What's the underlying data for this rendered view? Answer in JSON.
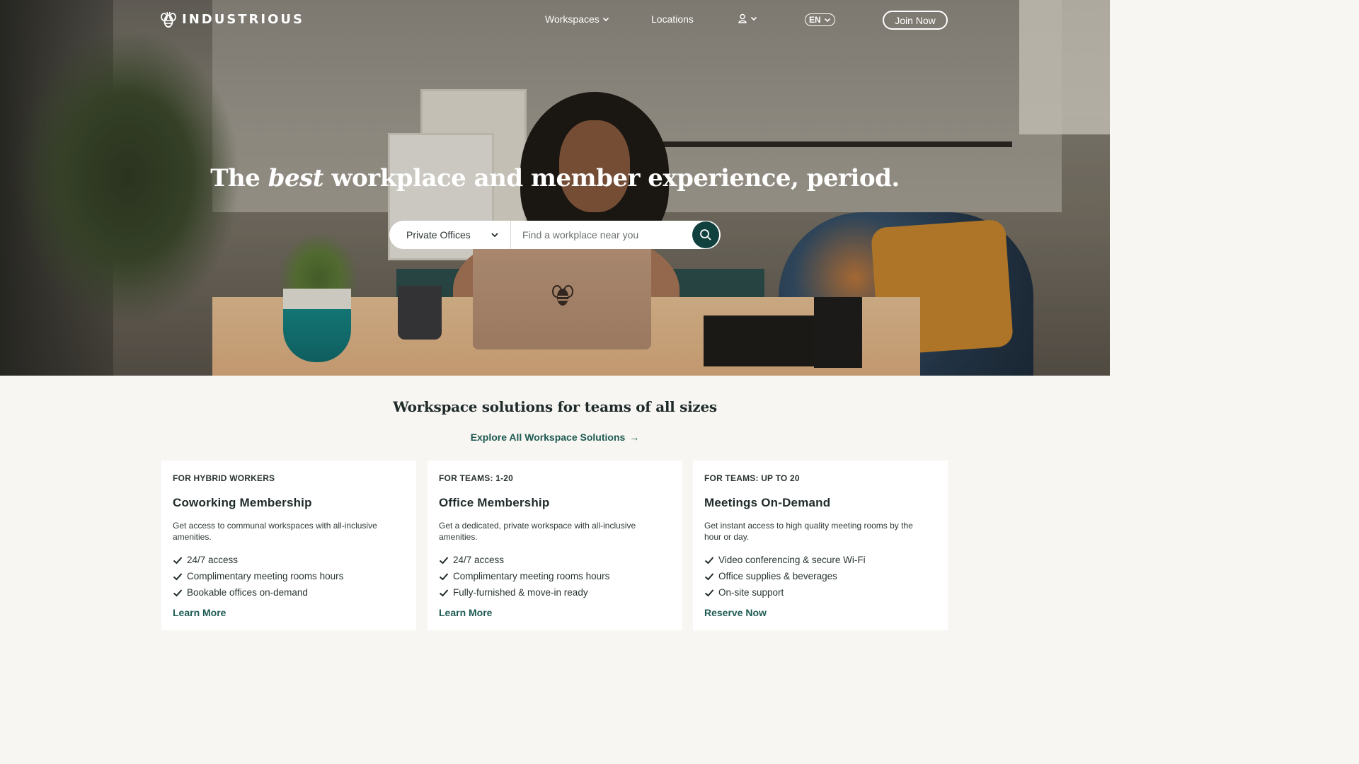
{
  "brand": {
    "name": "INDUSTRIOUS"
  },
  "nav": {
    "workspaces": "Workspaces",
    "locations": "Locations",
    "language": "EN",
    "join": "Join Now"
  },
  "hero": {
    "headline_pre": "The ",
    "headline_em": "best",
    "headline_post": " workplace and member experience, period."
  },
  "search": {
    "selected_type": "Private Offices",
    "placeholder": "Find a workplace near you",
    "value": ""
  },
  "solutions": {
    "title": "Workspace solutions for teams of all sizes",
    "explore": "Explore All Workspace Solutions",
    "cards": [
      {
        "eyebrow": "FOR HYBRID WORKERS",
        "title": "Coworking Membership",
        "desc": "Get access to communal workspaces with all-inclusive amenities.",
        "features": [
          "24/7 access",
          "Complimentary meeting rooms hours",
          "Bookable offices on-demand"
        ],
        "cta": "Learn More"
      },
      {
        "eyebrow": "FOR TEAMS: 1-20",
        "title": "Office Membership",
        "desc": "Get a dedicated, private workspace with all-inclusive amenities.",
        "features": [
          "24/7 access",
          "Complimentary meeting rooms hours",
          "Fully-furnished & move-in ready"
        ],
        "cta": "Learn More"
      },
      {
        "eyebrow": "FOR TEAMS: UP TO 20",
        "title": "Meetings On-Demand",
        "desc": "Get instant access to high quality meeting rooms by the hour or day.",
        "features": [
          "Video conferencing & secure Wi-Fi",
          "Office supplies & beverages",
          "On-site support"
        ],
        "cta": "Reserve Now"
      }
    ]
  },
  "colors": {
    "brand_green": "#11413f",
    "link_green": "#1d5a52",
    "page_bg": "#f8f6f2"
  },
  "icons": [
    "bee-logo-icon",
    "chevron-down-icon",
    "user-icon",
    "search-icon",
    "arrow-right-icon",
    "checkmark-icon"
  ]
}
